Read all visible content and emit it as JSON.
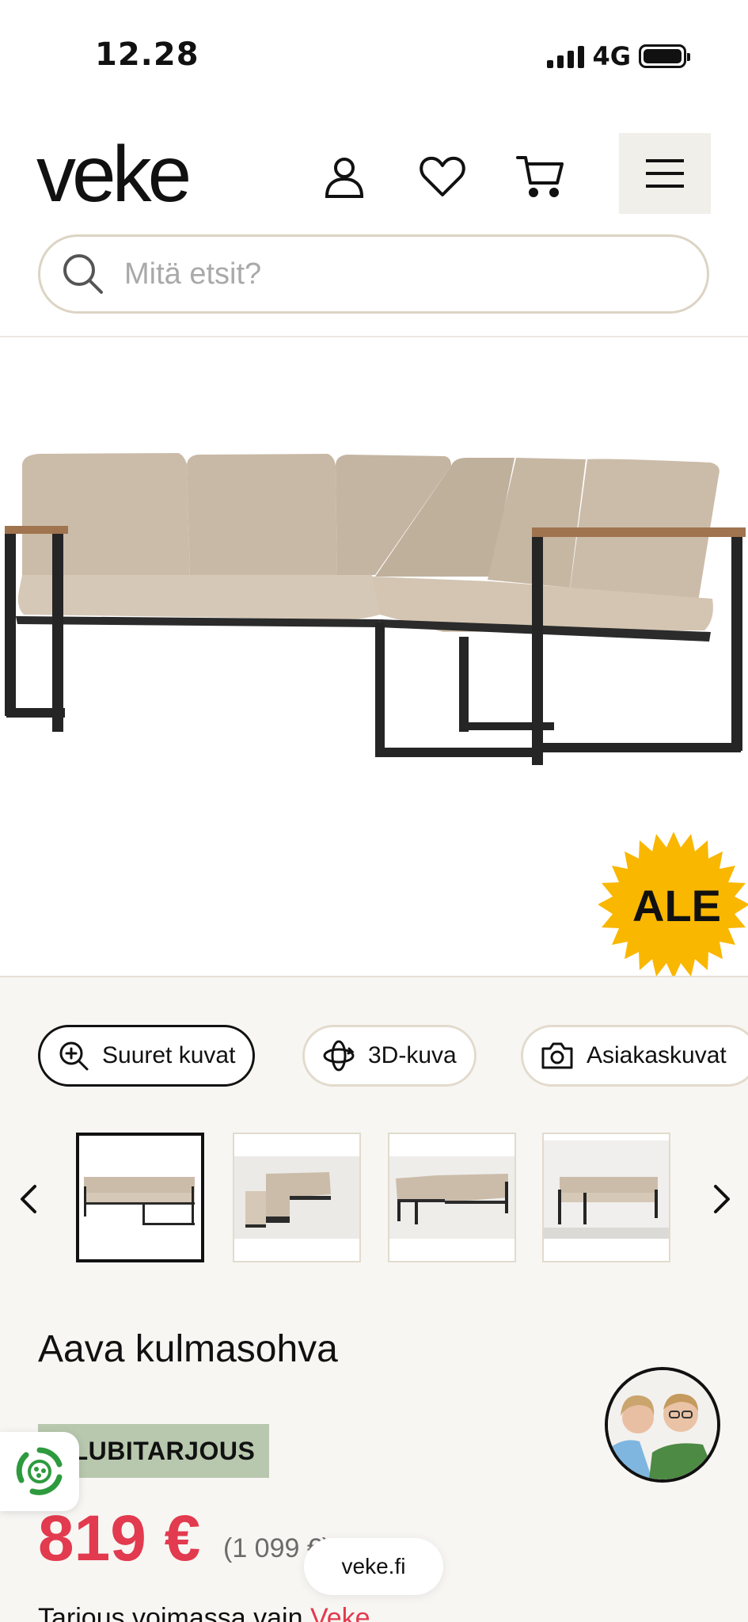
{
  "status_bar": {
    "time": "12.28",
    "network": "4G",
    "signal_bars": 4,
    "battery_level": 0.9
  },
  "header": {
    "logo": "veke",
    "icons": [
      "user-icon",
      "heart-icon",
      "cart-icon",
      "menu-icon"
    ],
    "search": {
      "placeholder": "Mitä etsit?",
      "value": ""
    }
  },
  "product": {
    "sale_badge": "ALE",
    "media_buttons": [
      {
        "label": "Suuret kuvat",
        "icon": "zoom-in-icon"
      },
      {
        "label": "3D-kuva",
        "icon": "rotate-3d-icon"
      },
      {
        "label": "Asiakaskuvat",
        "icon": "camera-icon"
      }
    ],
    "thumbnails_count": 4,
    "active_thumbnail": 1,
    "title": "Aava kulmasohva",
    "club_badge": "KLUBITARJOUS",
    "price": "819 €",
    "old_price": "(1 099 €)",
    "note_prefix": "Tarjous voimassa vain",
    "note_link": "Veke"
  },
  "footer": {
    "url": "veke.fi"
  },
  "colors": {
    "accent": "#e23a4e",
    "badge_yellow": "#f9b700",
    "club_green": "#b8c8ae",
    "chip_border": "#e2dbcd"
  }
}
